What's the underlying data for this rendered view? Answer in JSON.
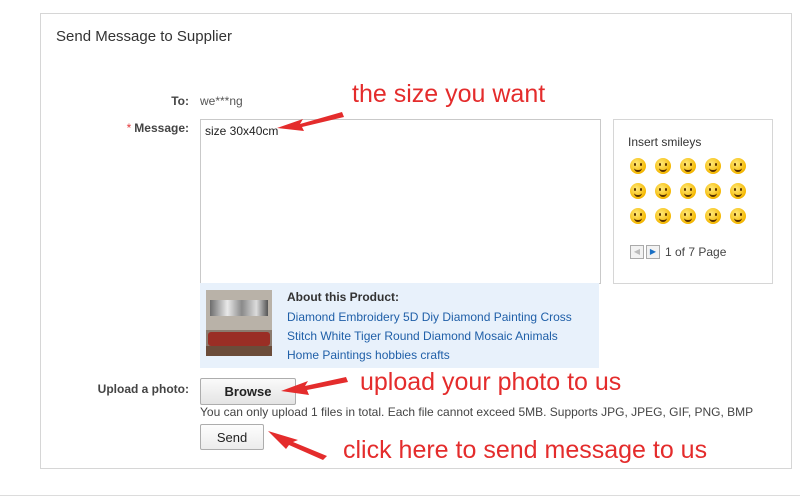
{
  "panel": {
    "title": "Send Message to Supplier"
  },
  "form": {
    "to_label": "To:",
    "to_value": "we***ng",
    "required_mark": "*",
    "message_label": "Message:",
    "message_value": "size 30x40cm",
    "upload_label": "Upload a photo:",
    "browse_label": "Browse",
    "upload_note": "You can only upload 1 files in total. Each file cannot exceed 5MB. Supports JPG, JPEG, GIF, PNG, BMP",
    "send_label": "Send"
  },
  "smileys": {
    "title": "Insert smileys",
    "icons": [
      "smile-icon",
      "tongue-icon",
      "wink-icon",
      "laugh-icon",
      "dizzy-icon",
      "angry-icon",
      "cry-laugh-icon",
      "hot-icon",
      "nervous-icon",
      "sleepy-icon",
      "grin-icon",
      "shy-icon",
      "cool-icon",
      "shocked-icon",
      "kiss-icon"
    ],
    "pager_text": "1 of 7 Page",
    "prev_glyph": "◀",
    "next_glyph": "▶"
  },
  "product": {
    "about_title": "About this Product:",
    "link_text": "Diamond Embroidery 5D Diy Diamond Painting Cross Stitch White Tiger Round Diamond Mosaic Animals Home Paintings hobbies crafts"
  },
  "annotations": {
    "size": "the size you want",
    "upload": "upload your photo to us",
    "send": "click here to send message to us"
  },
  "colors": {
    "annotation": "#e42c2c",
    "link": "#1f5fa8",
    "product_bg": "#e8f1fb"
  }
}
